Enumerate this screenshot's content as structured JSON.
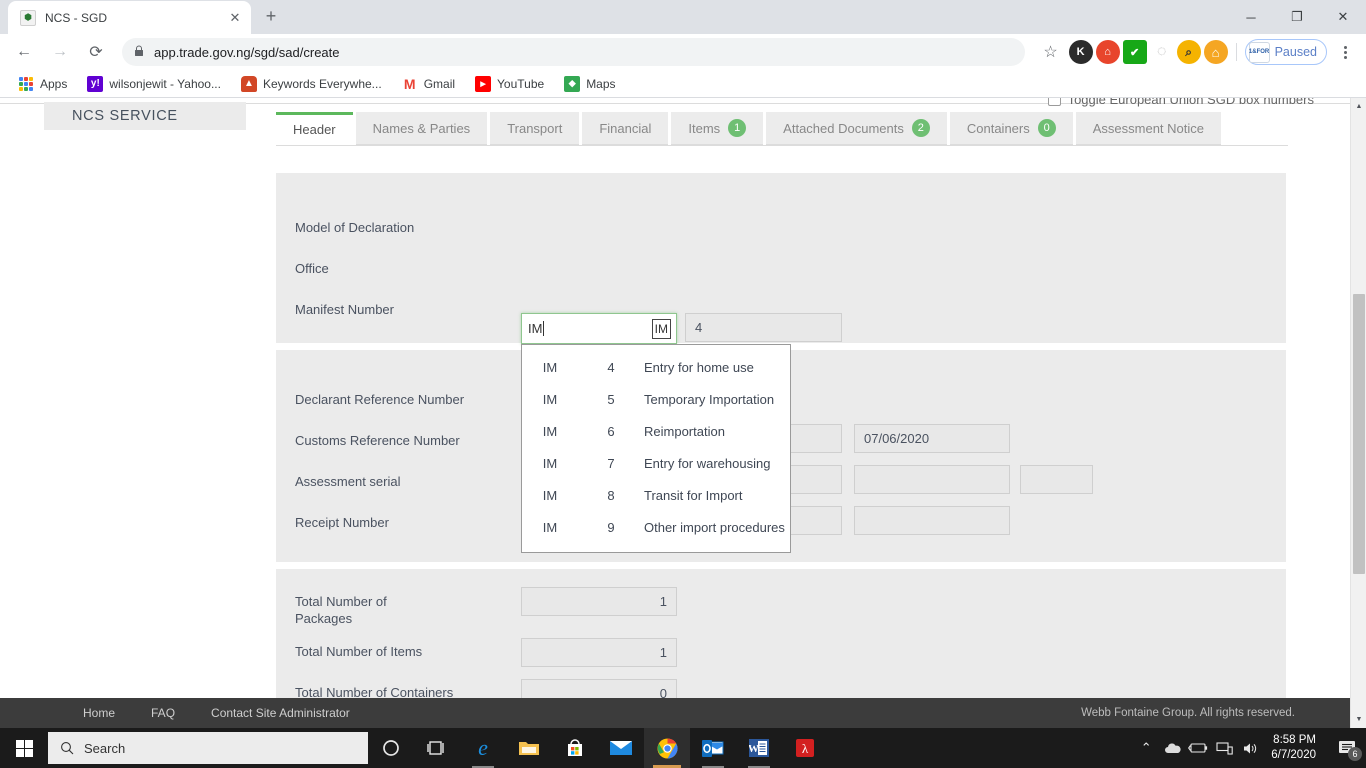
{
  "browser": {
    "tab": {
      "title": "NCS - SGD",
      "favicon": "nigeria-coat-of-arms-icon",
      "close": "✕"
    },
    "new_tab_label": "+",
    "window_controls": {
      "minimize": "─",
      "maximize": "❐",
      "close": "✕"
    },
    "nav": {
      "back": "←",
      "forward": "→",
      "reload": "⟳"
    },
    "omnibox": {
      "lock": "🔒",
      "url": "app.trade.gov.ng/sgd/sad/create",
      "star": "☆"
    },
    "extensions": [
      {
        "name": "kaspersky-extension-icon",
        "glyph": "K",
        "color": "#2b2b2b"
      },
      {
        "name": "lastpass-extension-icon",
        "glyph": "⌂",
        "color": "#e8452c"
      },
      {
        "name": "checkmark-extension-icon",
        "glyph": "✔",
        "color": "#17a817"
      },
      {
        "name": "grey-circle-extension-icon",
        "glyph": "◌",
        "color": "#bdbdbd"
      },
      {
        "name": "search-magnifier-extension-icon",
        "glyph": "🔍",
        "color": "#f5b300"
      },
      {
        "name": "home-extension-icon",
        "glyph": "⌂",
        "color": "#f5a623"
      }
    ],
    "profile_pill": {
      "logo_line1": "e",
      "logo_line2": "1&FOR",
      "label": "Paused"
    },
    "bookmarks": [
      {
        "name": "apps-bookmark",
        "label": "Apps",
        "icon": "apps-grid-icon",
        "color": ""
      },
      {
        "name": "yahoo-bookmark",
        "label": "wilsonjewit - Yahoo...",
        "icon": "yahoo-icon",
        "glyph": "y!",
        "color": "#6001d2"
      },
      {
        "name": "keywords-everywhere-bookmark",
        "label": "Keywords Everywhe...",
        "icon": "keywords-icon",
        "glyph": "",
        "color": "#d24726"
      },
      {
        "name": "gmail-bookmark",
        "label": "Gmail",
        "icon": "gmail-icon",
        "glyph": "M",
        "color": "#ea4335"
      },
      {
        "name": "youtube-bookmark",
        "label": "YouTube",
        "icon": "youtube-icon",
        "glyph": "▶",
        "color": "#ff0000"
      },
      {
        "name": "maps-bookmark",
        "label": "Maps",
        "icon": "maps-icon",
        "glyph": "📍",
        "color": "#34a853"
      }
    ]
  },
  "page": {
    "brand": "NCS SERVICE",
    "eu_toggle_label": "Toggle European Union SGD box numbers",
    "tabs": [
      {
        "label": "Header",
        "badge": null,
        "active": true
      },
      {
        "label": "Names & Parties",
        "badge": null,
        "active": false
      },
      {
        "label": "Transport",
        "badge": null,
        "active": false
      },
      {
        "label": "Financial",
        "badge": null,
        "active": false
      },
      {
        "label": "Items",
        "badge": "1",
        "active": false
      },
      {
        "label": "Attached Documents",
        "badge": "2",
        "active": false
      },
      {
        "label": "Containers",
        "badge": "0",
        "active": false
      },
      {
        "label": "Assessment Notice",
        "badge": null,
        "active": false
      }
    ],
    "section1": {
      "rows": [
        {
          "label": "Model of Declaration",
          "value2": "4"
        },
        {
          "label": "Office"
        },
        {
          "label": "Manifest Number"
        }
      ]
    },
    "combo": {
      "value": "IM",
      "hint": "IM"
    },
    "dropdown": {
      "options": [
        {
          "code": "IM",
          "num": "4",
          "desc": "Entry for home use"
        },
        {
          "code": "IM",
          "num": "5",
          "desc": "Temporary Importation"
        },
        {
          "code": "IM",
          "num": "6",
          "desc": "Reimportation"
        },
        {
          "code": "IM",
          "num": "7",
          "desc": "Entry for warehousing"
        },
        {
          "code": "IM",
          "num": "8",
          "desc": "Transit for Import"
        },
        {
          "code": "IM",
          "num": "9",
          "desc": "Other import procedures"
        }
      ]
    },
    "section2": {
      "rows": [
        {
          "label": "Declarant Reference Number"
        },
        {
          "label": "Customs Reference Number",
          "date": "07/06/2020"
        },
        {
          "label": "Assessment serial"
        },
        {
          "label": "Receipt Number"
        }
      ]
    },
    "section3": {
      "rows": [
        {
          "label": "Total Number of Packages",
          "value": "1"
        },
        {
          "label": "Total Number of Items",
          "value": "1"
        },
        {
          "label": "Total Number of Containers",
          "value": "0"
        }
      ]
    },
    "footer": {
      "links": [
        "Home",
        "FAQ",
        "Contact Site Administrator"
      ],
      "copyright": "Webb Fontaine Group. All rights reserved."
    },
    "scrollbar": {
      "up": "▲",
      "down": "▼"
    }
  },
  "taskbar": {
    "search_placeholder": "Search",
    "search_icon": "magnifier-icon",
    "cortana_icon": "cortana-circle-icon",
    "taskview_icon": "task-view-icon",
    "apps": [
      {
        "name": "edge-taskbar-icon",
        "glyph": "e",
        "color": "#0b7ec4"
      },
      {
        "name": "file-explorer-taskbar-icon",
        "glyph": "🗀",
        "color": "#ffc955"
      },
      {
        "name": "microsoft-store-taskbar-icon",
        "glyph": "▤",
        "color": "#ffffff"
      },
      {
        "name": "mail-taskbar-icon",
        "glyph": "✉",
        "color": "#1a8fe3"
      },
      {
        "name": "chrome-taskbar-icon",
        "glyph": "◉",
        "color": "#4285f4"
      },
      {
        "name": "outlook-taskbar-icon",
        "glyph": "O",
        "color": "#0f6cbd"
      },
      {
        "name": "word-taskbar-icon",
        "glyph": "W",
        "color": "#2b579a"
      },
      {
        "name": "adobe-reader-taskbar-icon",
        "glyph": "A",
        "color": "#d32020"
      }
    ],
    "tray": {
      "chevron": "⌃",
      "onedrive": "☁",
      "battery": "🔋",
      "network": "🖧",
      "volume": "🔊",
      "time": "8:58 PM",
      "date": "6/7/2020",
      "notifications": "6"
    }
  }
}
